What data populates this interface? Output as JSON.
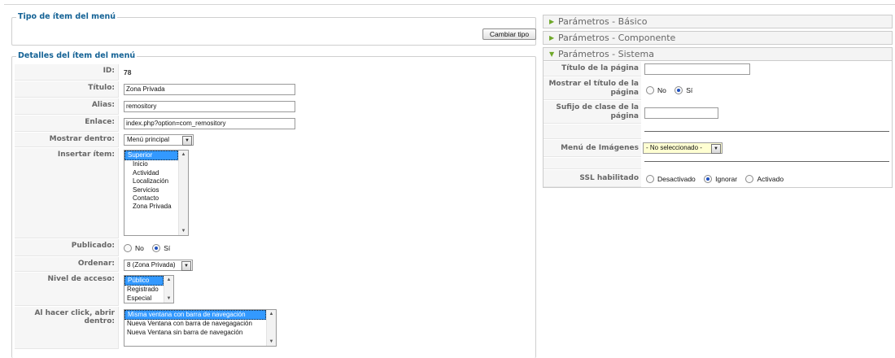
{
  "type_fieldset": {
    "legend": "Tipo de ítem del menú",
    "change_button": "Cambiar tipo"
  },
  "details": {
    "legend": "Detalles del ítem del menú",
    "id_label": "ID:",
    "id_value": "78",
    "title_label": "Título:",
    "title_value": "Zona Privada",
    "alias_label": "Alias:",
    "alias_value": "remository",
    "link_label": "Enlace:",
    "link_value": "index.php?option=com_remository",
    "show_in_label": "Mostrar dentro:",
    "show_in_value": "Menú principal",
    "insert_label": "Insertar ítem:",
    "insert_options": [
      "Superior",
      "Inicio",
      "Actividad",
      "Localización",
      "Servicios",
      "Contacto",
      "Zona Privada"
    ],
    "published_label": "Publicado:",
    "published_no": "No",
    "published_yes": "Sí",
    "order_label": "Ordenar:",
    "order_value": "8 (Zona Privada)",
    "access_label": "Nivel de acceso:",
    "access_options": [
      "Público",
      "Registrado",
      "Especial"
    ],
    "click_label": "Al hacer click, abrir dentro:",
    "click_options": [
      "Misma ventana con barra de navegación",
      "Nueva Ventana con barra de navegagación",
      "Nueva Ventana sin barra de navegación"
    ]
  },
  "panels": {
    "basic": "Parámetros - Básico",
    "component": "Parámetros - Componente",
    "system": "Parámetros - Sistema"
  },
  "system": {
    "page_title_label": "Título de la página",
    "show_title_label": "Mostrar el título de la página",
    "show_title_no": "No",
    "show_title_yes": "Sí",
    "css_suffix_label": "Sufijo de clase de la página",
    "image_menu_label": "Menú de Imágenes",
    "image_menu_value": "- No seleccionado -",
    "ssl_label": "SSL habilitado",
    "ssl_off": "Desactivado",
    "ssl_ignore": "Ignorar",
    "ssl_on": "Activado"
  },
  "colors": {
    "legend": "#146295",
    "selected_option": "#3399ff",
    "expanded_arrow": "#6fa82a"
  }
}
